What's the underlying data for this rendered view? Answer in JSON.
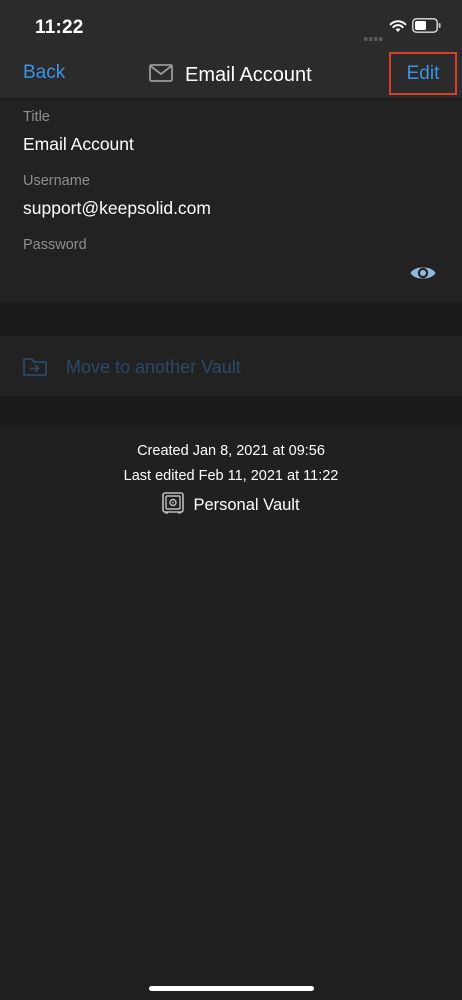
{
  "status_bar": {
    "time": "11:22",
    "icons": [
      "cellular-signal-icon",
      "wifi-icon",
      "battery-icon"
    ]
  },
  "nav": {
    "back_label": "Back",
    "title": "Email Account",
    "title_icon": "envelope-icon",
    "edit_label": "Edit",
    "accent_color": "#3b95e6",
    "highlight_color": "#d6402a"
  },
  "fields": [
    {
      "label": "Title",
      "value": "Email Account"
    },
    {
      "label": "Username",
      "value": "support@keepsolid.com"
    },
    {
      "label": "Password",
      "value": "",
      "action_icon": "eye-icon"
    }
  ],
  "actions": {
    "move_label": "Move to another Vault",
    "move_icon": "folder-move-icon"
  },
  "meta": {
    "created": "Created Jan 8, 2021 at 09:56",
    "last_edited": "Last edited Feb 11, 2021 at 11:22",
    "vault_label": "Personal Vault",
    "vault_icon": "safe-icon"
  }
}
